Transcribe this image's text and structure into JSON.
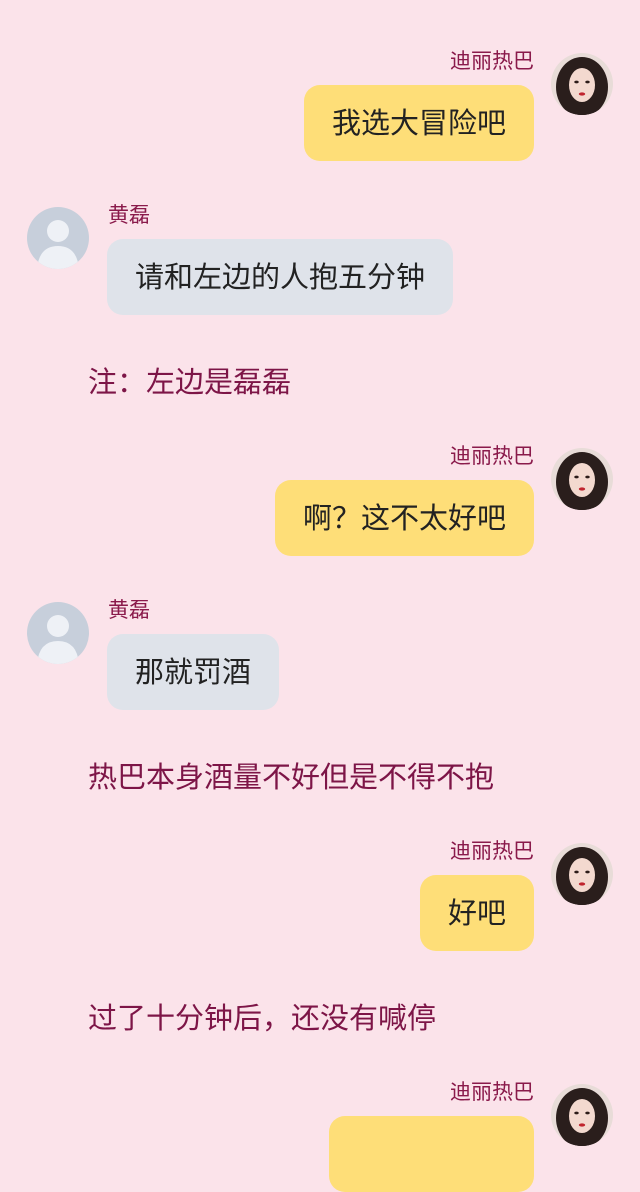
{
  "participants": {
    "right": {
      "name": "迪丽热巴"
    },
    "left": {
      "name": "黄磊"
    }
  },
  "messages": [
    {
      "speaker": "迪丽热巴",
      "text": "我选大冒险吧"
    },
    {
      "speaker": "黄磊",
      "text": "请和左边的人抱五分钟"
    },
    {
      "narration": "注：左边是磊磊"
    },
    {
      "speaker": "迪丽热巴",
      "text": "啊？这不太好吧"
    },
    {
      "speaker": "黄磊",
      "text": "那就罚酒"
    },
    {
      "narration": "热巴本身酒量不好但是不得不抱"
    },
    {
      "speaker": "迪丽热巴",
      "text": "好吧"
    },
    {
      "narration": "过了十分钟后，还没有喊停"
    },
    {
      "speaker": "迪丽热巴",
      "text": ""
    }
  ]
}
